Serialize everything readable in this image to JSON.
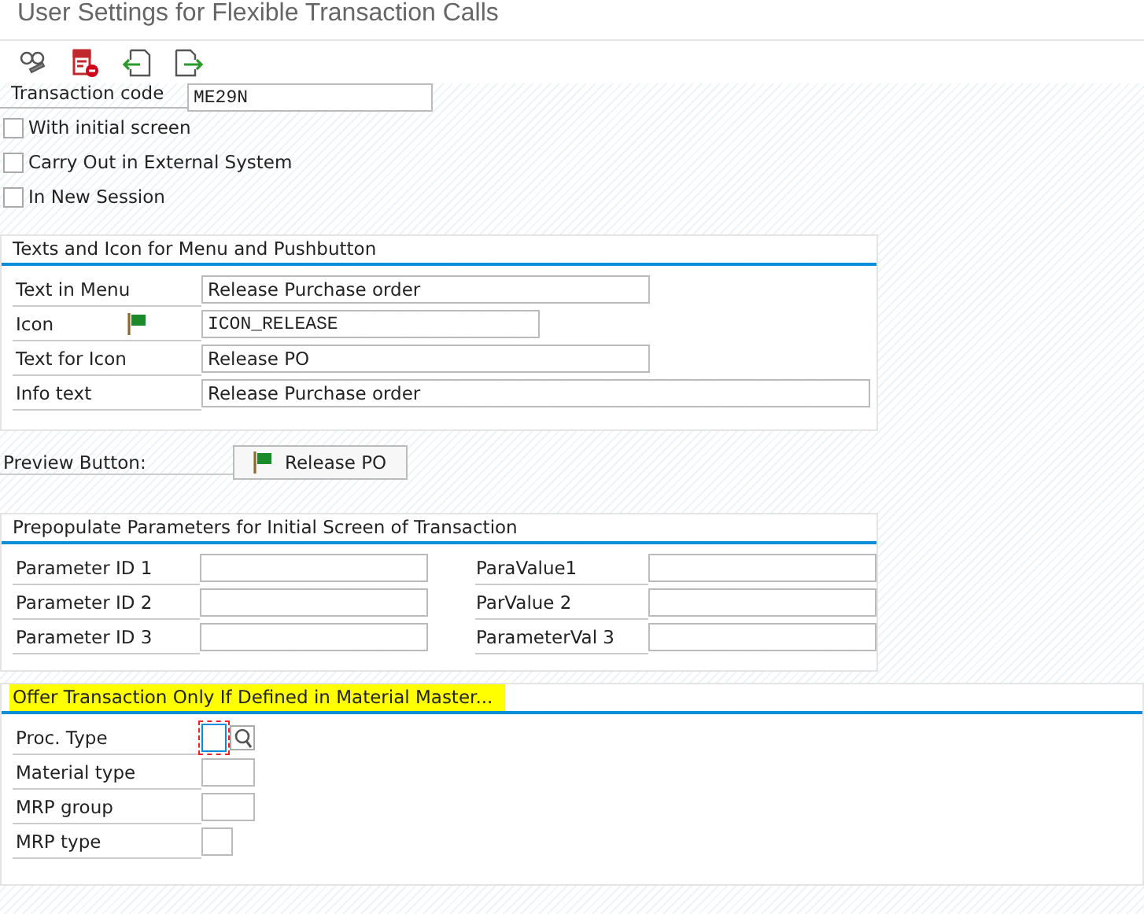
{
  "window": {
    "title": "User Settings for Flexible Transaction Calls"
  },
  "transaction": {
    "label": "Transaction code",
    "value": "ME29N"
  },
  "options": [
    {
      "label": "With initial screen",
      "checked": false
    },
    {
      "label": "Carry Out in External System",
      "checked": false
    },
    {
      "label": "In New Session",
      "checked": false
    }
  ],
  "texts_group": {
    "title": "Texts and Icon for Menu and Pushbutton",
    "rows": [
      {
        "label": "Text in Menu",
        "value": "Release Purchase order",
        "mono": false,
        "icon": false
      },
      {
        "label": "Icon",
        "value": "ICON_RELEASE",
        "mono": true,
        "icon": true
      },
      {
        "label": "Text for Icon",
        "value": "Release PO",
        "mono": false,
        "icon": false
      },
      {
        "label": "Info text",
        "value": "Release Purchase order",
        "mono": false,
        "icon": false
      }
    ]
  },
  "preview": {
    "label": "Preview Button:",
    "button": "Release PO"
  },
  "params_group": {
    "title": "Prepopulate Parameters for Initial Screen of Transaction",
    "rows": [
      {
        "id_label": "Parameter ID 1",
        "value_label": "ParaValue1"
      },
      {
        "id_label": "Parameter ID 2",
        "value_label": "ParValue 2"
      },
      {
        "id_label": "Parameter ID 3",
        "value_label": "ParameterVal 3"
      }
    ]
  },
  "material_group": {
    "title": "Offer Transaction Only If Defined in Material Master...",
    "highlighted": true,
    "rows": [
      {
        "label": "Proc. Type",
        "focused": true,
        "search": true
      },
      {
        "label": "Material type",
        "focused": false,
        "search": false
      },
      {
        "label": "MRP group",
        "focused": false,
        "search": false
      },
      {
        "label": "MRP type",
        "focused": false,
        "search": false
      }
    ]
  }
}
